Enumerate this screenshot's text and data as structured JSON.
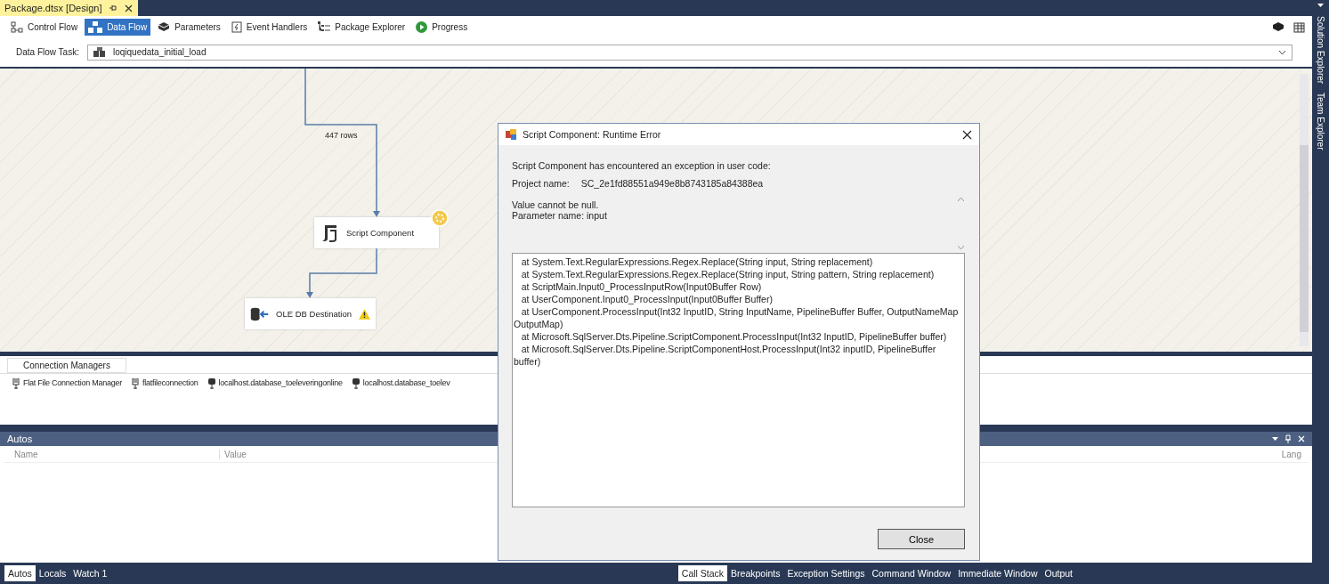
{
  "document_tab": {
    "title": "Package.dtsx [Design]"
  },
  "designer_tabs": [
    {
      "label": "Control Flow",
      "selected": false
    },
    {
      "label": "Data Flow",
      "selected": true
    },
    {
      "label": "Parameters",
      "selected": false
    },
    {
      "label": "Event Handlers",
      "selected": false
    },
    {
      "label": "Package Explorer",
      "selected": false
    },
    {
      "label": "Progress",
      "selected": false
    }
  ],
  "side_tabs": [
    "Solution Explorer",
    "Team Explorer"
  ],
  "task": {
    "label": "Data Flow Task:",
    "value": "loqiquedata_initial_load"
  },
  "canvas": {
    "path_label": "447 rows",
    "nodes": [
      {
        "label": "Script Component",
        "running": true,
        "warning": false
      },
      {
        "label": "OLE DB Destination",
        "running": false,
        "warning": true
      }
    ]
  },
  "connection_managers": {
    "title": "Connection Managers",
    "items": [
      {
        "label": "Flat File Connection Manager",
        "kind": "file"
      },
      {
        "label": "flatfileconnection",
        "kind": "file"
      },
      {
        "label": "localhost.database_toeleveringonline",
        "kind": "database"
      },
      {
        "label": "localhost.database_toelev",
        "kind": "database"
      }
    ]
  },
  "autos": {
    "title": "Autos",
    "columns": [
      "Name",
      "Value",
      "Lang"
    ]
  },
  "bottom_left_tabs": [
    {
      "label": "Autos",
      "selected": true
    },
    {
      "label": "Locals",
      "selected": false
    },
    {
      "label": "Watch 1",
      "selected": false
    }
  ],
  "bottom_right_tabs": [
    {
      "label": "Call Stack",
      "selected": true
    },
    {
      "label": "Breakpoints",
      "selected": false
    },
    {
      "label": "Exception Settings",
      "selected": false
    },
    {
      "label": "Command Window",
      "selected": false
    },
    {
      "label": "Immediate Window",
      "selected": false
    },
    {
      "label": "Output",
      "selected": false
    }
  ],
  "dialog": {
    "title": "Script Component: Runtime Error",
    "message": "Script Component has encountered an exception in user code:",
    "project_label": "Project name:",
    "project_name": "SC_2e1fd88551a949e8b8743185a84388ea",
    "error_lines": [
      "Value cannot be null.",
      "Parameter name: input"
    ],
    "stack": [
      "   at System.Text.RegularExpressions.Regex.Replace(String input, String replacement)",
      "   at System.Text.RegularExpressions.Regex.Replace(String input, String pattern, String replacement)",
      "   at ScriptMain.Input0_ProcessInputRow(Input0Buffer Row)",
      "   at UserComponent.Input0_ProcessInput(Input0Buffer Buffer)",
      "   at UserComponent.ProcessInput(Int32 InputID, String InputName, PipelineBuffer Buffer, OutputNameMap OutputMap)",
      "   at Microsoft.SqlServer.Dts.Pipeline.ScriptComponent.ProcessInput(Int32 InputID, PipelineBuffer buffer)",
      "   at Microsoft.SqlServer.Dts.Pipeline.ScriptComponentHost.ProcessInput(Int32 inputID, PipelineBuffer buffer)"
    ],
    "close_button": "Close"
  }
}
